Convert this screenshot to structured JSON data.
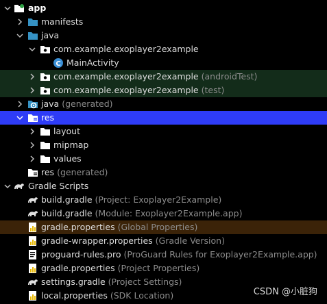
{
  "project_tree": {
    "rows": [
      {
        "label": "app",
        "secondary": ""
      },
      {
        "label": "manifests",
        "secondary": ""
      },
      {
        "label": "java",
        "secondary": ""
      },
      {
        "label": "com.example.exoplayer2example",
        "secondary": ""
      },
      {
        "label": "MainActivity",
        "secondary": ""
      },
      {
        "label": "com.example.exoplayer2example",
        "secondary": "(androidTest)"
      },
      {
        "label": "com.example.exoplayer2example",
        "secondary": "(test)"
      },
      {
        "label": "java",
        "secondary": "(generated)"
      },
      {
        "label": "res",
        "secondary": ""
      },
      {
        "label": "layout",
        "secondary": ""
      },
      {
        "label": "mipmap",
        "secondary": ""
      },
      {
        "label": "values",
        "secondary": ""
      },
      {
        "label": "res",
        "secondary": "(generated)"
      },
      {
        "label": "Gradle Scripts",
        "secondary": ""
      },
      {
        "label": "build.gradle",
        "secondary": "(Project: Exoplayer2Example)"
      },
      {
        "label": "build.gradle",
        "secondary": "(Module: Exoplayer2Example.app)"
      },
      {
        "label": "gradle.properties",
        "secondary": "(Global Properties)"
      },
      {
        "label": "gradle-wrapper.properties",
        "secondary": "(Gradle Version)"
      },
      {
        "label": "proguard-rules.pro",
        "secondary": "(ProGuard Rules for Exoplayer2Example.app)"
      },
      {
        "label": "gradle.properties",
        "secondary": "(Project Properties)"
      },
      {
        "label": "settings.gradle",
        "secondary": "(Project Settings)"
      },
      {
        "label": "local.properties",
        "secondary": "(SDK Location)"
      }
    ]
  },
  "colors": {
    "folder": "#3592c4",
    "class_badge": "#3a8fd6",
    "selection": "#2e3cf7",
    "test_highlight": "#132c1a",
    "properties_highlight": "#3b2308"
  },
  "watermark": "CSDN @小脏狗"
}
